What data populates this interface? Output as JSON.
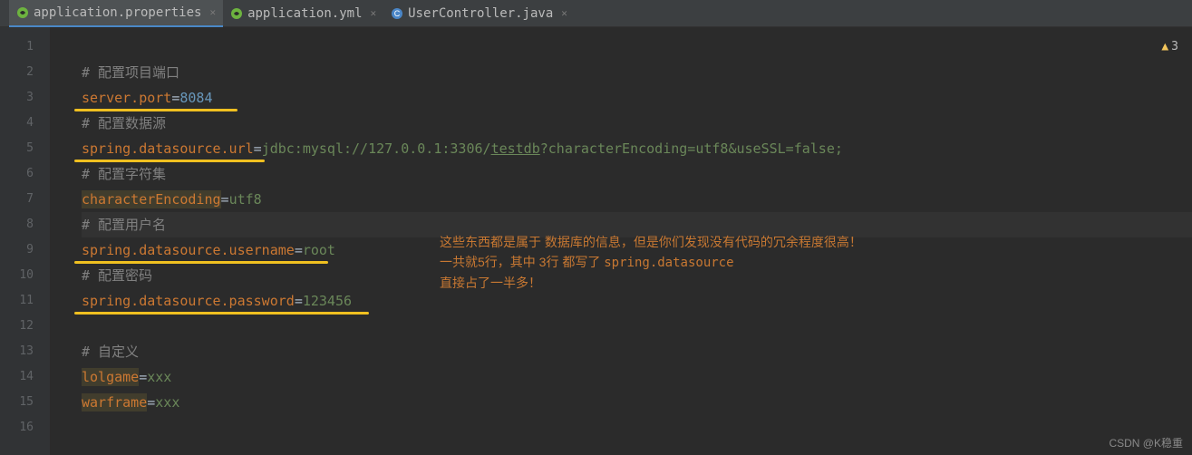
{
  "tabs": [
    {
      "label": "application.properties",
      "active": true,
      "icon": "spring"
    },
    {
      "label": "application.yml",
      "active": false,
      "icon": "spring"
    },
    {
      "label": "UserController.java",
      "active": false,
      "icon": "class"
    }
  ],
  "warning": {
    "count": "3"
  },
  "code": {
    "l2_comment": "# 配置项目端口",
    "l3_key": "server.port",
    "l3_val": "8084",
    "l4_comment": "# 配置数据源",
    "l5_key": "spring.datasource.url",
    "l5_prefix": "jdbc:mysql://127.0.0.1:3306/",
    "l5_db": "testdb",
    "l5_suffix": "?characterEncoding=utf8&useSSL=false;",
    "l6_comment": "# 配置字符集",
    "l7_key": "characterEncoding",
    "l7_val": "utf8",
    "l8_comment": "# 配置用户名",
    "l9_key": "spring.datasource.username",
    "l9_val": "root",
    "l10_comment": "# 配置密码",
    "l11_key": "spring.datasource.password",
    "l11_val": "123456",
    "l13_comment": "# 自定义",
    "l14_key": "lolgame",
    "l14_val": "xxx",
    "l15_key": "warframe",
    "l15_val": "xxx"
  },
  "annotation": {
    "line1": "这些东西都是属于 数据库的信息，但是你们发现没有代码的冗余程度很高！",
    "line2_a": "一共就5行，其中 3行 都写了 ",
    "line2_b": "spring.datasource",
    "line3": "直接占了一半多！"
  },
  "watermark": "CSDN @K稳重"
}
